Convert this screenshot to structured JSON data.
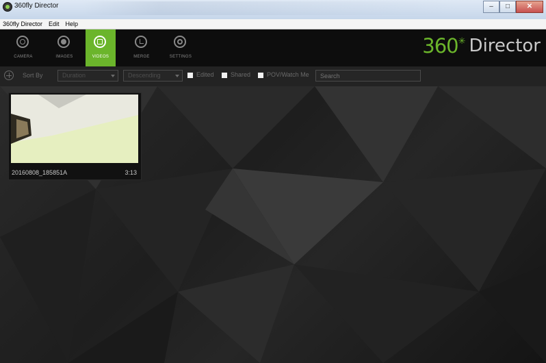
{
  "window": {
    "title": "360fly Director"
  },
  "menu": [
    "360fly Director",
    "Edit",
    "Help"
  ],
  "nav": [
    {
      "label": "CAMERA",
      "icon": "camera-icon"
    },
    {
      "label": "IMAGES",
      "icon": "images-icon"
    },
    {
      "label": "VIDEOS",
      "icon": "videos-icon",
      "active": true
    },
    {
      "label": "MERGE",
      "icon": "merge-icon"
    },
    {
      "label": "SETTINGS",
      "icon": "settings-icon"
    }
  ],
  "brand": {
    "number": "360",
    "word": "Director",
    "accent": "#6bb52b"
  },
  "toolbar": {
    "sort_label": "Sort By",
    "sort_field": "Duration",
    "sort_order": "Descending",
    "filters": [
      "Edited",
      "Shared",
      "POV/Watch Me"
    ],
    "search_placeholder": "Search"
  },
  "videos": [
    {
      "name": "20160808_185851A",
      "duration": "3:13"
    }
  ]
}
